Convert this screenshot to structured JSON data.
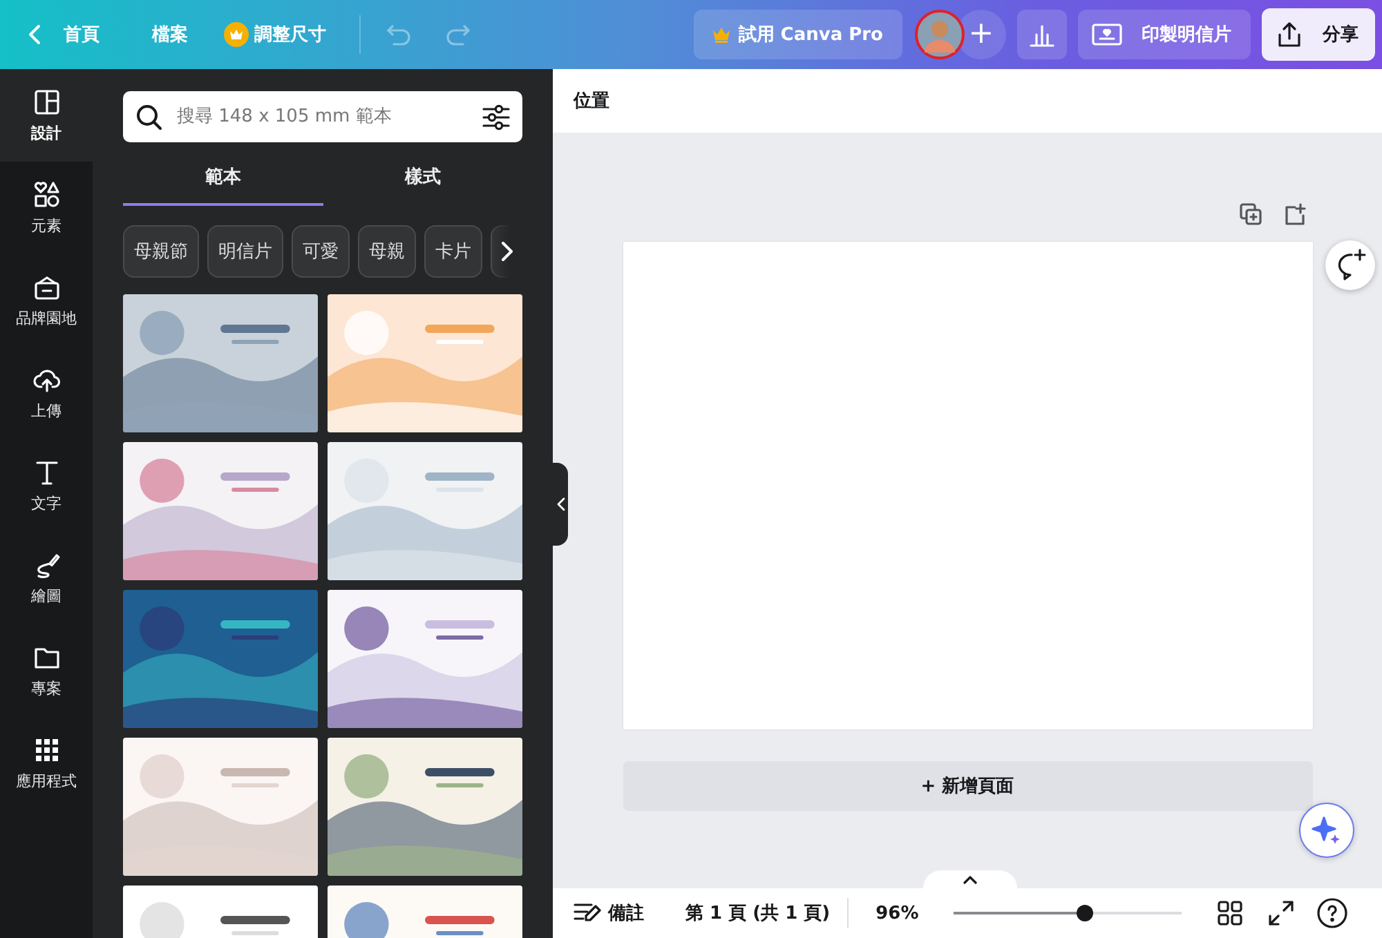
{
  "top_bar": {
    "home": "首頁",
    "file": "檔案",
    "resize": "調整尺寸",
    "undo": {
      "disabled": true
    },
    "redo": {
      "disabled": true
    },
    "pro_button": "試用 Canva Pro",
    "add": "+",
    "print_button": "印製明信片",
    "share_button": "分享"
  },
  "sidebar": {
    "items": [
      {
        "label": "設計",
        "selected": true
      },
      {
        "label": "元素",
        "selected": false
      },
      {
        "label": "品牌園地",
        "selected": false
      },
      {
        "label": "上傳",
        "selected": false
      },
      {
        "label": "文字",
        "selected": false
      },
      {
        "label": "繪圖",
        "selected": false
      },
      {
        "label": "專案",
        "selected": false
      },
      {
        "label": "應用程式",
        "selected": false
      }
    ]
  },
  "panel": {
    "search": {
      "placeholder": "搜尋 148 x 105 mm 範本"
    },
    "tabs": [
      {
        "label": "範本",
        "selected": true
      },
      {
        "label": "樣式",
        "selected": false
      }
    ],
    "chips": [
      "母親節",
      "明信片",
      "可愛",
      "母親",
      "卡片"
    ]
  },
  "canvas": {
    "header": "位置",
    "add_page": "+ 新增頁面"
  },
  "bottom_bar": {
    "notes": "備註",
    "page_info": "第 1 頁 (共 1 頁)",
    "zoom": "96%",
    "zoom_slider": {
      "level": 0.58
    }
  }
}
